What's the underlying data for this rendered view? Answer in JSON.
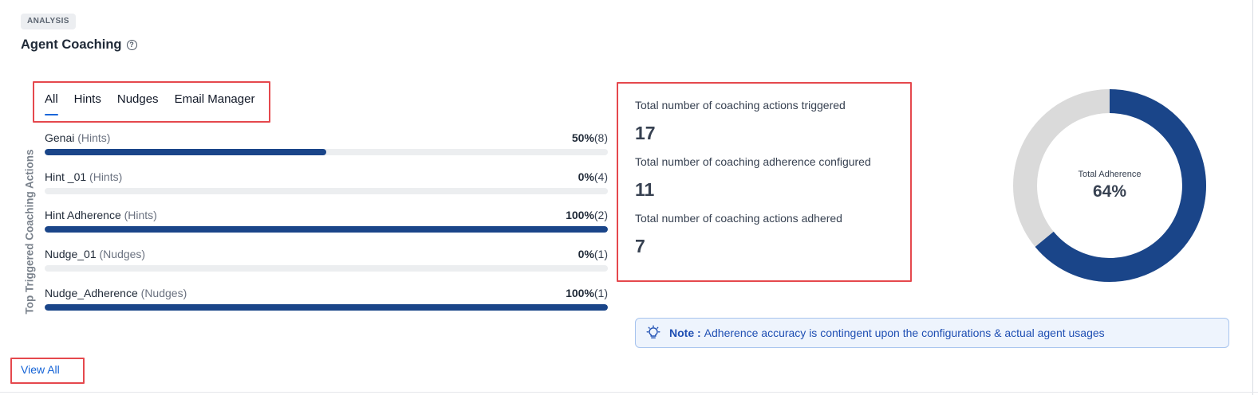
{
  "header": {
    "badge": "ANALYSIS",
    "title": "Agent Coaching"
  },
  "tabs": [
    {
      "label": "All",
      "active": true
    },
    {
      "label": "Hints",
      "active": false
    },
    {
      "label": "Nudges",
      "active": false
    },
    {
      "label": "Email Manager",
      "active": false
    }
  ],
  "list": {
    "axis_label": "Top Triggered Coaching Actions",
    "items": [
      {
        "name": "Genai",
        "type": "(Hints)",
        "percent_text": "50%",
        "count_text": "(8)",
        "percent": 50
      },
      {
        "name": "Hint _01",
        "type": "(Hints)",
        "percent_text": "0%",
        "count_text": "(4)",
        "percent": 0
      },
      {
        "name": "Hint Adherence",
        "type": "(Hints)",
        "percent_text": "100%",
        "count_text": "(2)",
        "percent": 100
      },
      {
        "name": "Nudge_01",
        "type": "(Nudges)",
        "percent_text": "0%",
        "count_text": "(1)",
        "percent": 0
      },
      {
        "name": "Nudge_Adherence",
        "type": "(Nudges)",
        "percent_text": "100%",
        "count_text": "(1)",
        "percent": 100
      }
    ],
    "view_all": "View All"
  },
  "stats": [
    {
      "label": "Total number of coaching actions triggered",
      "value": "17"
    },
    {
      "label": "Total number of coaching adherence configured",
      "value": "11"
    },
    {
      "label": "Total number of coaching actions adhered",
      "value": "7"
    }
  ],
  "donut": {
    "label": "Total Adherence",
    "value_text": "64%",
    "percent": 64,
    "fill_color": "#1a4589",
    "track_color": "#dadada"
  },
  "note": {
    "title": "Note :",
    "text": "Adherence accuracy is contingent upon the configurations & actual agent usages"
  },
  "colors": {
    "accent": "#1a66d9",
    "bar_fill": "#1a4589",
    "highlight": "#e5484d",
    "link": "#1463d6"
  }
}
